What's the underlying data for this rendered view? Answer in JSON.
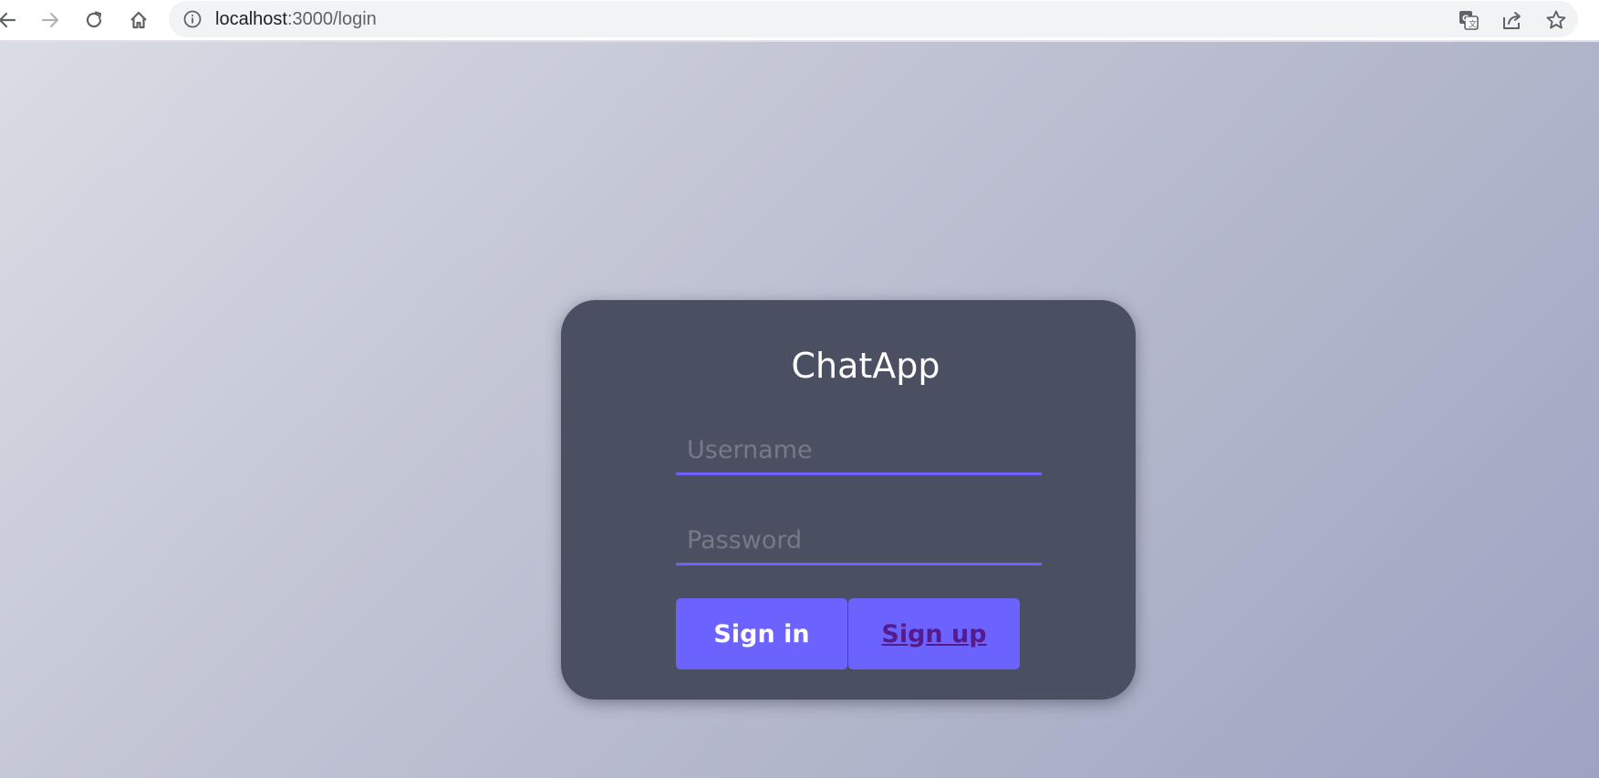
{
  "browser": {
    "url_host": "localhost",
    "url_path": ":3000/login"
  },
  "app": {
    "title": "ChatApp",
    "username_placeholder": "Username",
    "password_placeholder": "Password",
    "signin_label": "Sign in",
    "signup_label": "Sign up"
  },
  "colors": {
    "accent": "#6c63ff",
    "card": "#4a5062",
    "link_visited": "#551a8b"
  },
  "icons": {
    "back": "back-arrow-icon",
    "forward": "forward-arrow-icon",
    "reload": "reload-icon",
    "home": "home-icon",
    "info": "info-icon",
    "translate": "translate-icon",
    "share": "share-icon",
    "bookmark": "star-icon"
  }
}
